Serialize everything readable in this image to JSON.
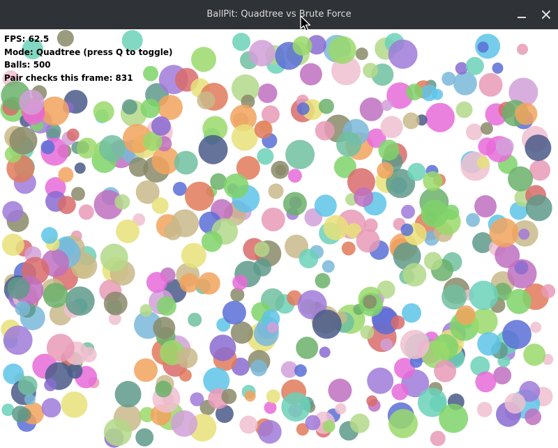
{
  "window": {
    "title": "BallPit: Quadtree vs Brute Force",
    "minimize_icon": "minimize-icon",
    "close_icon": "close-icon"
  },
  "hud": {
    "fps": "FPS: 62.5",
    "mode": "Mode: Quadtree (press Q to toggle)",
    "balls": "Balls: 500",
    "pair_checks": "Pair checks this frame: 831"
  },
  "simulation": {
    "ball_count": 500,
    "palette": [
      "#5ec4e8",
      "#e86bd9",
      "#7fd36a",
      "#f2a35e",
      "#8a6bd1",
      "#e8e27a",
      "#d96b6b",
      "#6bd1b8",
      "#a07ad9",
      "#c9b98a",
      "#6bb06b",
      "#e89ab7",
      "#5b6fd6",
      "#b3d98a",
      "#d1a0d9",
      "#7ab8d9",
      "#e07a5a",
      "#9ad96b",
      "#5e9a8a",
      "#f0c0d0",
      "#8a8a6a",
      "#c070c0",
      "#70c0a0",
      "#4a5a8a"
    ]
  }
}
